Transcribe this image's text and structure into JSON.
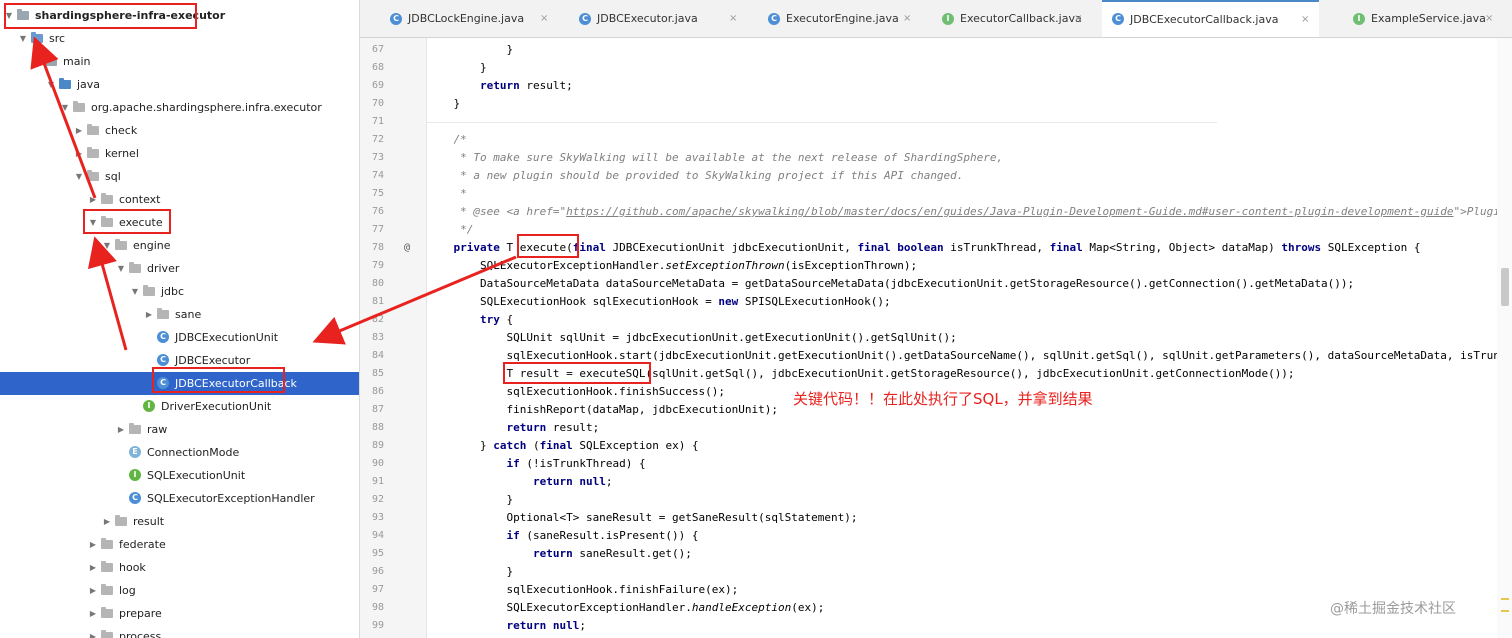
{
  "tree": {
    "items": [
      {
        "label": "shardingsphere-infra-executor",
        "indent": 0,
        "type": "module",
        "expanded": true
      },
      {
        "label": "src",
        "indent": 1,
        "type": "src",
        "expanded": true
      },
      {
        "label": "main",
        "indent": 2,
        "type": "folder",
        "expanded": true
      },
      {
        "label": "java",
        "indent": 3,
        "type": "java",
        "expanded": true
      },
      {
        "label": "org.apache.shardingsphere.infra.executor",
        "indent": 4,
        "type": "package",
        "expanded": true
      },
      {
        "label": "check",
        "indent": 5,
        "type": "package",
        "expanded": false
      },
      {
        "label": "kernel",
        "indent": 5,
        "type": "package",
        "expanded": false
      },
      {
        "label": "sql",
        "indent": 5,
        "type": "package",
        "expanded": true
      },
      {
        "label": "context",
        "indent": 6,
        "type": "package",
        "expanded": false
      },
      {
        "label": "execute",
        "indent": 6,
        "type": "package",
        "expanded": true
      },
      {
        "label": "engine",
        "indent": 7,
        "type": "package",
        "expanded": true
      },
      {
        "label": "driver",
        "indent": 8,
        "type": "package",
        "expanded": true
      },
      {
        "label": "jdbc",
        "indent": 9,
        "type": "package",
        "expanded": true
      },
      {
        "label": "sane",
        "indent": 10,
        "type": "package",
        "expanded": false
      },
      {
        "label": "JDBCExecutionUnit",
        "indent": 10,
        "type": "class"
      },
      {
        "label": "JDBCExecutor",
        "indent": 10,
        "type": "class"
      },
      {
        "label": "JDBCExecutorCallback",
        "indent": 10,
        "type": "class",
        "selected": true
      },
      {
        "label": "DriverExecutionUnit",
        "indent": 9,
        "type": "interface"
      },
      {
        "label": "raw",
        "indent": 8,
        "type": "package",
        "expanded": false
      },
      {
        "label": "ConnectionMode",
        "indent": 8,
        "type": "enum"
      },
      {
        "label": "SQLExecutionUnit",
        "indent": 8,
        "type": "interface"
      },
      {
        "label": "SQLExecutorExceptionHandler",
        "indent": 8,
        "type": "class"
      },
      {
        "label": "result",
        "indent": 7,
        "type": "package",
        "expanded": false
      },
      {
        "label": "federate",
        "indent": 6,
        "type": "package",
        "expanded": false
      },
      {
        "label": "hook",
        "indent": 6,
        "type": "package",
        "expanded": false
      },
      {
        "label": "log",
        "indent": 6,
        "type": "package",
        "expanded": false
      },
      {
        "label": "prepare",
        "indent": 6,
        "type": "package",
        "expanded": false
      },
      {
        "label": "process",
        "indent": 6,
        "type": "package",
        "expanded": false
      }
    ]
  },
  "tabs": [
    {
      "label": "JDBCLockEngine.java",
      "icon": "C",
      "icon_name": "class-icon"
    },
    {
      "label": "JDBCExecutor.java",
      "icon": "C",
      "icon_name": "class-icon"
    },
    {
      "label": "ExecutorEngine.java",
      "icon": "C",
      "icon_name": "class-icon"
    },
    {
      "label": "ExecutorCallback.java",
      "icon": "I",
      "icon_name": "interface-icon"
    },
    {
      "label": "JDBCExecutorCallback.java",
      "icon": "C",
      "icon_name": "class-icon",
      "active": true
    },
    {
      "label": "ExampleService.java",
      "icon": "I",
      "icon_name": "interface-icon"
    }
  ],
  "editor": {
    "first_line": 67,
    "line_numbers": [
      "67",
      "68",
      "69",
      "70",
      "71",
      "72",
      "73",
      "74",
      "75",
      "76",
      "77",
      "78",
      "79",
      "80",
      "81",
      "82",
      "83",
      "84",
      "85",
      "86",
      "87",
      "88",
      "89",
      "90",
      "91",
      "92",
      "93",
      "94",
      "95",
      "96",
      "97",
      "98",
      "99"
    ],
    "override_marker": "@",
    "lines": [
      [
        {
          "t": "            }"
        }
      ],
      [
        {
          "t": "        }"
        }
      ],
      [
        {
          "t": "        "
        },
        {
          "t": "return",
          "c": "kw"
        },
        {
          "t": " result;"
        }
      ],
      [
        {
          "t": "    }"
        }
      ],
      [
        {
          "t": ""
        }
      ],
      [
        {
          "t": "    /*",
          "c": "cm"
        }
      ],
      [
        {
          "t": "     * To make sure SkyWalking will be available at the next release of ShardingSphere,",
          "c": "cm"
        }
      ],
      [
        {
          "t": "     * a new plugin should be provided to SkyWalking project if this API changed.",
          "c": "cm"
        }
      ],
      [
        {
          "t": "     *",
          "c": "cm"
        }
      ],
      [
        {
          "t": "     * @see <a href=\"",
          "c": "cm"
        },
        {
          "t": "https://github.com/apache/skywalking/blob/master/docs/en/guides/Java-Plugin-Development-Guide.md#user-content-plugin-development-guide",
          "c": "lnk"
        },
        {
          "t": "\">Plugin D",
          "c": "cm"
        }
      ],
      [
        {
          "t": "     */",
          "c": "cm"
        }
      ],
      [
        {
          "t": "    "
        },
        {
          "t": "private",
          "c": "kw"
        },
        {
          "t": " T execute("
        },
        {
          "t": "final",
          "c": "kw"
        },
        {
          "t": " JDBCExecutionUnit jdbcExecutionUnit, "
        },
        {
          "t": "final boolean",
          "c": "kw"
        },
        {
          "t": " isTrunkThread, "
        },
        {
          "t": "final",
          "c": "kw"
        },
        {
          "t": " Map<String, Object> dataMap) "
        },
        {
          "t": "throws",
          "c": "kw"
        },
        {
          "t": " SQLException {"
        }
      ],
      [
        {
          "t": "        SQLExecutorExceptionHandler."
        },
        {
          "t": "setExceptionThrown",
          "c": "it"
        },
        {
          "t": "(isExceptionThrown);"
        }
      ],
      [
        {
          "t": "        DataSourceMetaData dataSourceMetaData = getDataSourceMetaData(jdbcExecutionUnit.getStorageResource().getConnection().getMetaData());"
        }
      ],
      [
        {
          "t": "        SQLExecutionHook sqlExecutionHook = "
        },
        {
          "t": "new",
          "c": "kw"
        },
        {
          "t": " SPISQLExecutionHook();"
        }
      ],
      [
        {
          "t": "        "
        },
        {
          "t": "try",
          "c": "kw"
        },
        {
          "t": " {"
        }
      ],
      [
        {
          "t": "            SQLUnit sqlUnit = jdbcExecutionUnit.getExecutionUnit().getSqlUnit();"
        }
      ],
      [
        {
          "t": "            sqlExecutionHook.start(jdbcExecutionUnit.getExecutionUnit().getDataSourceName(), sqlUnit.getSql(), sqlUnit.getParameters(), dataSourceMetaData, isTrunkThread, dataMap);"
        }
      ],
      [
        {
          "t": "            T result = executeSQL(sqlUnit.getSql(), jdbcExecutionUnit.getStorageResource(), jdbcExecutionUnit.getConnectionMode());"
        }
      ],
      [
        {
          "t": "            sqlExecutionHook.finishSuccess();"
        }
      ],
      [
        {
          "t": "            finishReport(dataMap, jdbcExecutionUnit);"
        }
      ],
      [
        {
          "t": "            "
        },
        {
          "t": "return",
          "c": "kw"
        },
        {
          "t": " result;"
        }
      ],
      [
        {
          "t": "        } "
        },
        {
          "t": "catch",
          "c": "kw"
        },
        {
          "t": " ("
        },
        {
          "t": "final",
          "c": "kw"
        },
        {
          "t": " SQLException ex) {"
        }
      ],
      [
        {
          "t": "            "
        },
        {
          "t": "if",
          "c": "kw"
        },
        {
          "t": " (!isTrunkThread) {"
        }
      ],
      [
        {
          "t": "                "
        },
        {
          "t": "return null",
          "c": "kw"
        },
        {
          "t": ";"
        }
      ],
      [
        {
          "t": "            }"
        }
      ],
      [
        {
          "t": "            Optional<T> saneResult = getSaneResult(sqlStatement);"
        }
      ],
      [
        {
          "t": "            "
        },
        {
          "t": "if",
          "c": "kw"
        },
        {
          "t": " (saneResult.isPresent()) {"
        }
      ],
      [
        {
          "t": "                "
        },
        {
          "t": "return",
          "c": "kw"
        },
        {
          "t": " saneResult.get();"
        }
      ],
      [
        {
          "t": "            }"
        }
      ],
      [
        {
          "t": "            sqlExecutionHook.finishFailure(ex);"
        }
      ],
      [
        {
          "t": "            SQLExecutorExceptionHandler."
        },
        {
          "t": "handleException",
          "c": "it"
        },
        {
          "t": "(ex);"
        }
      ],
      [
        {
          "t": "            "
        },
        {
          "t": "return null",
          "c": "kw"
        },
        {
          "t": ";"
        }
      ]
    ]
  },
  "annotation": {
    "note": "关键代码！！在此处执行了SQL，并拿到结果",
    "color": "#e8231f"
  },
  "watermark": "@稀土掘金技术社区",
  "colors": {
    "selection": "#2f65ca",
    "keyword": "#000080",
    "comment": "#808080",
    "annotation_red": "#e8231f"
  }
}
